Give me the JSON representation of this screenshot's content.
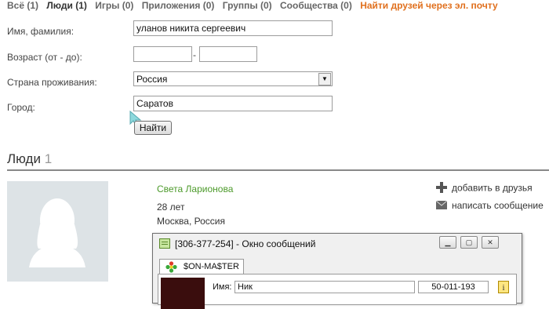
{
  "tabs": [
    {
      "label": "Всё (1)"
    },
    {
      "label": "Люди (1)"
    },
    {
      "label": "Игры (0)"
    },
    {
      "label": "Приложения (0)"
    },
    {
      "label": "Группы (0)"
    },
    {
      "label": "Сообщества (0)"
    },
    {
      "label": "Найти друзей через эл. почту"
    }
  ],
  "form": {
    "name_label": "Имя, фамилия:",
    "name_value": "уланов никита сергеевич",
    "age_label": "Возраст (от - до):",
    "age_dash": "-",
    "country_label": "Страна проживания:",
    "country_value": "Россия",
    "city_label": "Город:",
    "city_value": "Саратов",
    "find_button": "Найти"
  },
  "results": {
    "title": "Люди",
    "count": "1",
    "person": {
      "name": "Света Ларионова",
      "age": "28 лет",
      "location": "Москва, Россия"
    },
    "actions": {
      "add_friend": "добавить в друзья",
      "send_message": "написать сообщение"
    }
  },
  "icq_window": {
    "title": "[306-377-254] - Окно сообщений",
    "tab_label": "$ON-MA$TER",
    "name_label": "Имя:",
    "name_value": "Ник",
    "number_value": "50-011-193"
  },
  "colors": {
    "accent_orange": "#e0701e",
    "link_green": "#4c9a2a"
  }
}
